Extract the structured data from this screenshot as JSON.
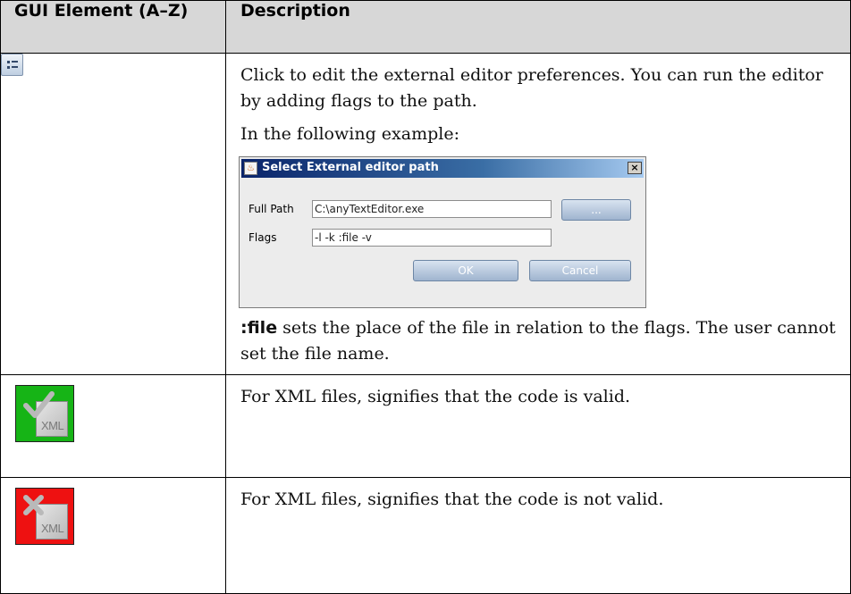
{
  "header": {
    "col1": "GUI Element (A–Z)",
    "col2": "Description"
  },
  "row1": {
    "icon": "settings-icon",
    "desc": "Click to edit the external editor preferences. You can run the editor by adding flags to the path.",
    "example_intro": "In the following example:",
    "dialog": {
      "title": "Select External editor path",
      "close_label": "×",
      "full_path_label": "Full Path",
      "full_path_value": "C:\\anyTextEditor.exe",
      "browse_label": "...",
      "flags_label": "Flags",
      "flags_value": "-l -k :file -v",
      "ok_label": "OK",
      "cancel_label": "Cancel"
    },
    "note_bold": ":file",
    "note_rest": " sets the place of the file in relation to the flags. The user cannot set the file name."
  },
  "row2": {
    "icon": "xml-valid-icon",
    "icon_text": "XML",
    "icon_color": "#16b416",
    "desc": "For XML files, signifies that the code is valid."
  },
  "row3": {
    "icon": "xml-invalid-icon",
    "icon_text": "XML",
    "icon_color": "#ee1111",
    "desc": "For XML files, signifies that the code is not valid."
  }
}
